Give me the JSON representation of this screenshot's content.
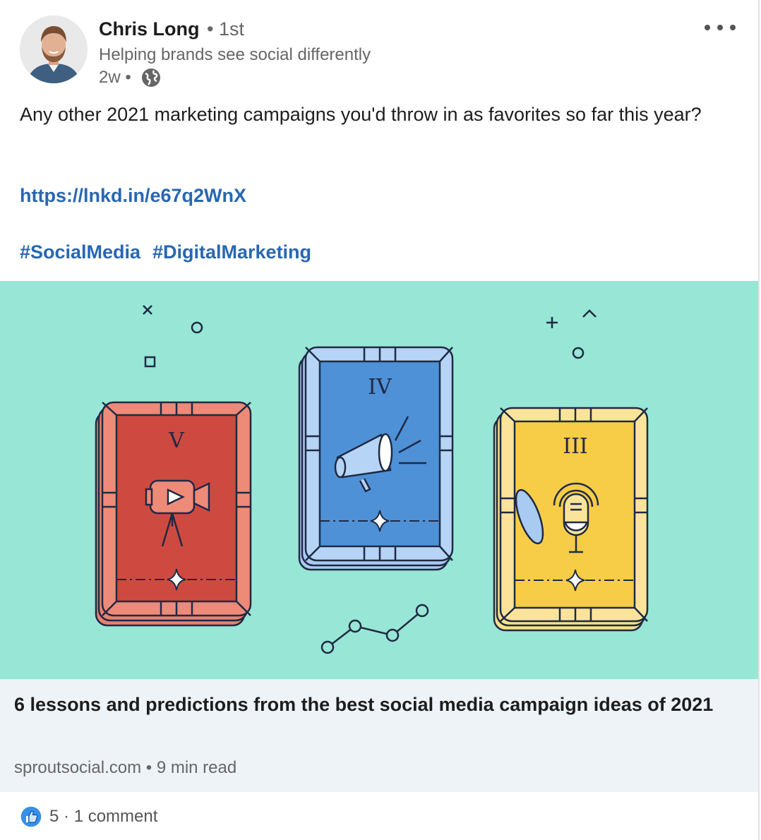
{
  "post": {
    "author": {
      "name": "Chris Long",
      "degree": "1st",
      "headline": "Helping brands see social differently",
      "time": "2w"
    },
    "text": "Any other 2021 marketing campaigns you'd throw in as favorites so far this year?",
    "link": "https://lnkd.in/e67q2WnX",
    "hashtags": [
      "#SocialMedia",
      "#DigitalMarketing"
    ]
  },
  "article": {
    "numerals": [
      "V",
      "IV",
      "III"
    ],
    "title": "6 lessons and predictions from the best social media campaign ideas of 2021",
    "source": "sproutsocial.com",
    "read_time": "9 min read"
  },
  "social": {
    "likes": "5",
    "comments": "1 comment"
  },
  "icons": {
    "globe": "globe-icon",
    "more": "more-icon",
    "like": "like-icon"
  },
  "colors": {
    "link": "#2867b2",
    "hero_bg": "#98e6d6",
    "red_card": "#ce4a41",
    "blue_card": "#4f91d7",
    "yellow_card": "#f7cd47",
    "article_bg": "#eef3f8"
  }
}
